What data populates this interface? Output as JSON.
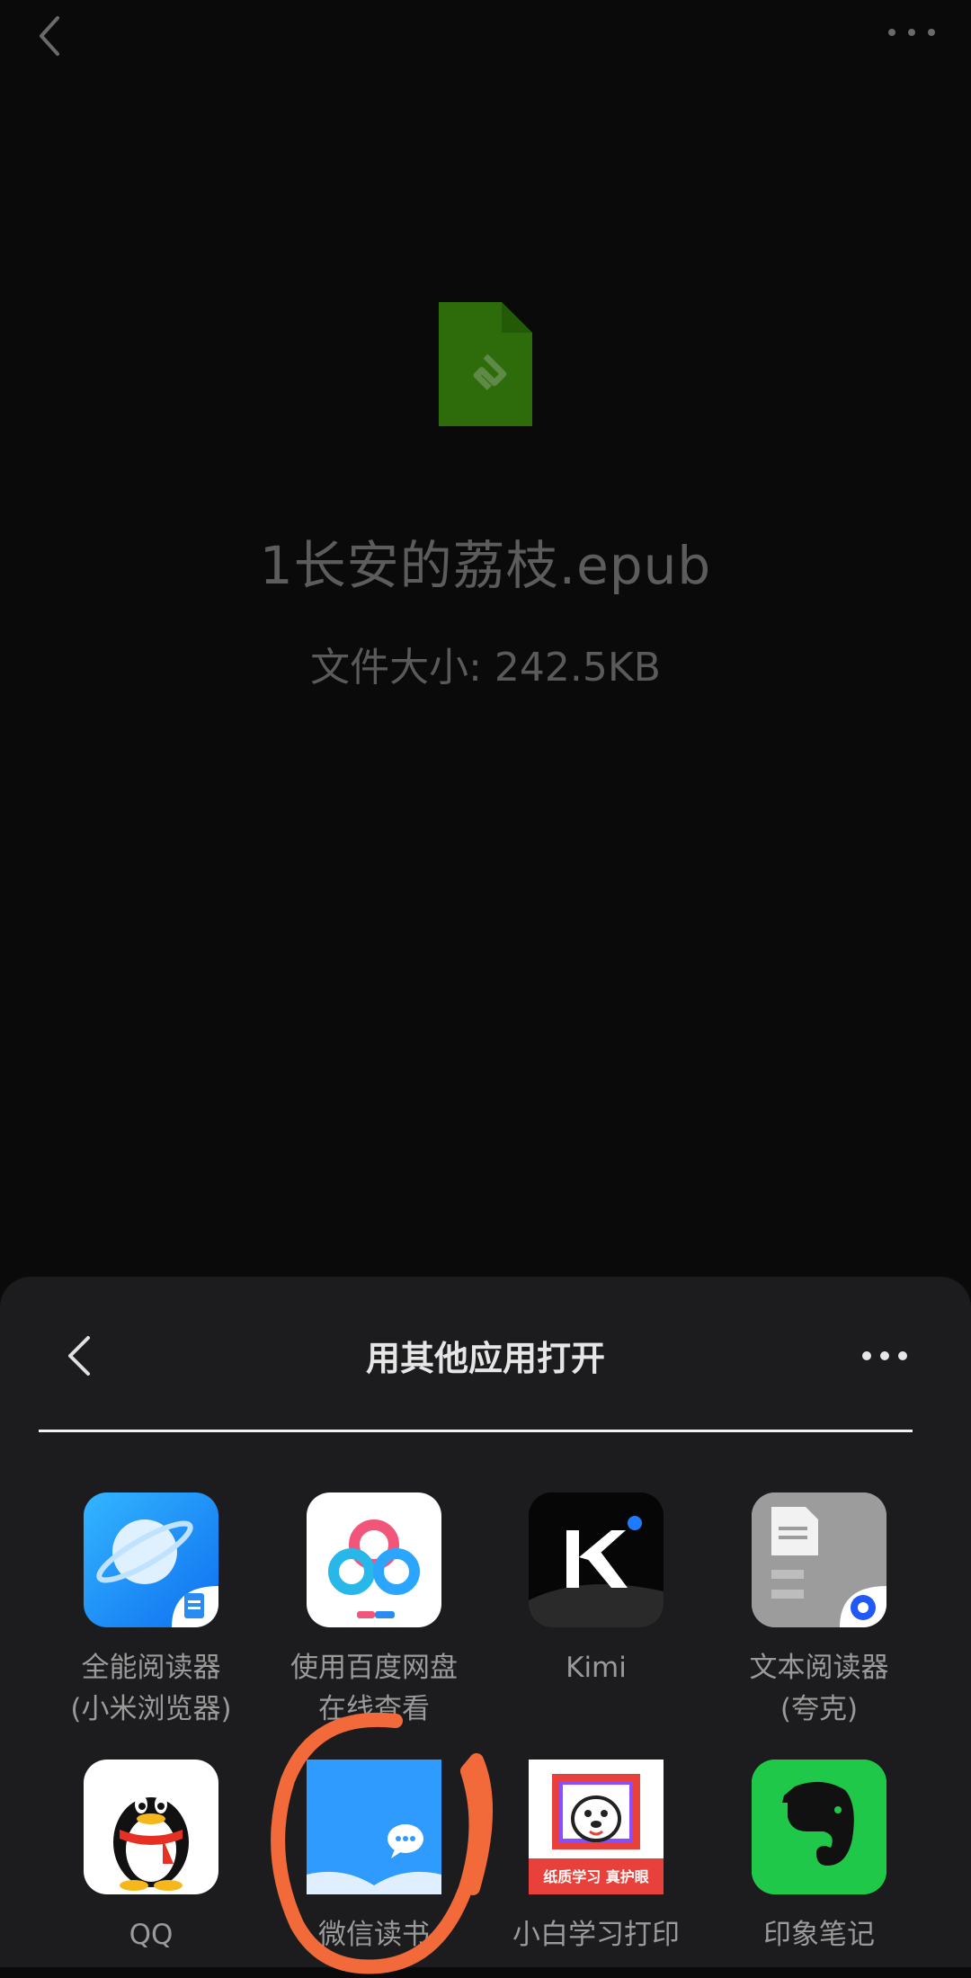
{
  "file": {
    "name": "1长安的荔枝.epub",
    "size_text": "文件大小: 242.5KB"
  },
  "sheet": {
    "title": "用其他应用打开"
  },
  "apps": [
    {
      "name": "全能阅读器\n(小米浏览器)"
    },
    {
      "name": "使用百度网盘\n在线查看"
    },
    {
      "name": "Kimi"
    },
    {
      "name": "文本阅读器\n(夸克)"
    },
    {
      "name": "QQ"
    },
    {
      "name": "微信读书"
    },
    {
      "name": "小白学习打印"
    },
    {
      "name": "印象笔记"
    }
  ],
  "icon_texts": {
    "xiaobai_banner": "纸质学习 真护眼"
  },
  "colors": {
    "background": "#0a0a0a",
    "sheet": "#1c1c1e",
    "epub_green": "#2e6b0a",
    "annotation": "#f26a3a"
  }
}
